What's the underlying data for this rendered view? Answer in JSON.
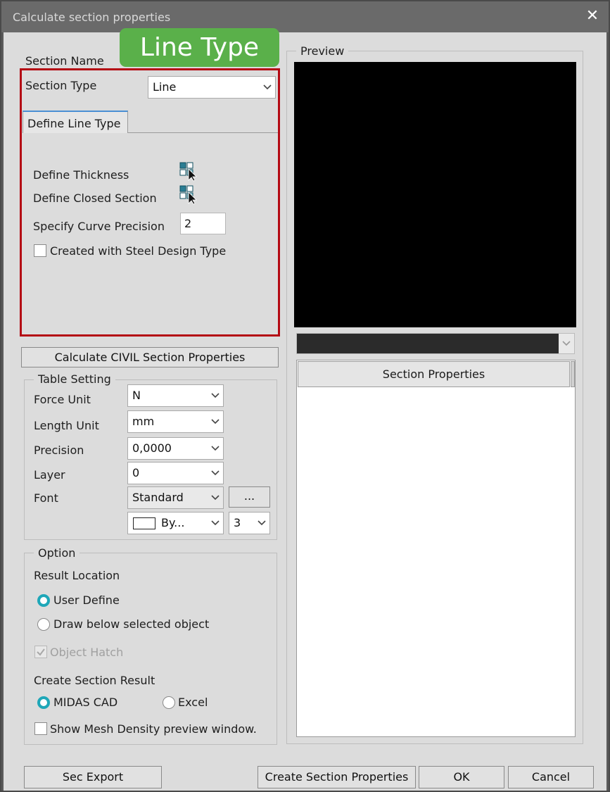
{
  "window": {
    "title": "Calculate section properties",
    "close_glyph": "✕"
  },
  "badge": {
    "text": "Line Type"
  },
  "section": {
    "name_label": "Section Name",
    "type_label": "Section Type",
    "type_value": "Line"
  },
  "tab": {
    "label": "Define Line Type"
  },
  "define": {
    "thickness_label": "Define Thickness",
    "closed_label": "Define Closed Section",
    "precision_label": "Specify Curve Precision",
    "precision_value": "2",
    "steel_label": "Created with Steel Design Type"
  },
  "calc_button": "Calculate CIVIL Section Properties",
  "table_setting": {
    "title": "Table Setting",
    "force_label": "Force Unit",
    "force_value": "N",
    "length_label": "Length Unit",
    "length_value": "mm",
    "precision_label": "Precision",
    "precision_value": "0,0000",
    "layer_label": "Layer",
    "layer_value": "0",
    "font_label": "Font",
    "font_value": "Standard",
    "font_more": "...",
    "color_value": "By...",
    "size_value": "3"
  },
  "option": {
    "title": "Option",
    "result_location_label": "Result Location",
    "user_define": "User Define",
    "draw_below": "Draw below selected object",
    "object_hatch": "Object Hatch",
    "create_result_label": "Create Section Result",
    "midas_cad": "MIDAS CAD",
    "excel": "Excel",
    "mesh_density": "Show Mesh Density preview window."
  },
  "preview": {
    "title": "Preview"
  },
  "properties": {
    "header": "Section Properties"
  },
  "footer": {
    "sec_export": "Sec Export",
    "create": "Create Section Properties",
    "ok": "OK",
    "cancel": "Cancel"
  },
  "colors": {
    "highlight": "#b40a14",
    "badge": "#5ab04a",
    "radio_accent": "#1ea7b8",
    "tab_accent": "#4a8fd4",
    "preview_bg": "#000000"
  },
  "icons": [
    "close-icon",
    "chevron-down-icon",
    "pick-object-icon"
  ]
}
